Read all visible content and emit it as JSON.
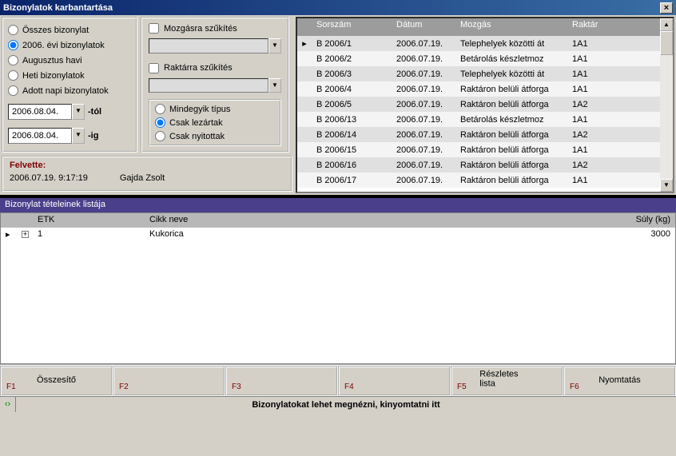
{
  "title": "Bizonylatok karbantartása",
  "filters": {
    "radios": [
      "Összes bizonylat",
      "2006. évi bizonylatok",
      "Augusztus havi",
      "Heti bizonylatok",
      "Adott napi bizonylatok"
    ],
    "dateFrom": "2006.08.04.",
    "dateTo": "2006.08.04.",
    "fromLbl": "-tól",
    "toLbl": "-ig",
    "chkMozgas": "Mozgásra szűkítés",
    "chkRaktar": "Raktárra szűkítés",
    "types": [
      "Mindegyik típus",
      "Csak lezártak",
      "Csak nyitottak"
    ]
  },
  "felvette": {
    "label": "Felvette:",
    "ts": "2006.07.19. 9:17:19",
    "user": "Gajda Zsolt"
  },
  "grid": {
    "headers": [
      "Sorszám",
      "Dátum",
      "Mozgás",
      "Raktár"
    ],
    "rows": [
      {
        "s": "B 2006/1",
        "d": "2006.07.19.",
        "m": "Telephelyek közötti át",
        "r": "1A1"
      },
      {
        "s": "B 2006/2",
        "d": "2006.07.19.",
        "m": "Betárolás készletmoz",
        "r": "1A1"
      },
      {
        "s": "B 2006/3",
        "d": "2006.07.19.",
        "m": "Telephelyek közötti át",
        "r": "1A1"
      },
      {
        "s": "B 2006/4",
        "d": "2006.07.19.",
        "m": "Raktáron belüli átforga",
        "r": "1A1"
      },
      {
        "s": "B 2006/5",
        "d": "2006.07.19.",
        "m": "Raktáron belüli átforga",
        "r": "1A2"
      },
      {
        "s": "B 2006/13",
        "d": "2006.07.19.",
        "m": "Betárolás készletmoz",
        "r": "1A1"
      },
      {
        "s": "B 2006/14",
        "d": "2006.07.19.",
        "m": "Raktáron belüli átforga",
        "r": "1A2"
      },
      {
        "s": "B 2006/15",
        "d": "2006.07.19.",
        "m": "Raktáron belüli átforga",
        "r": "1A1"
      },
      {
        "s": "B 2006/16",
        "d": "2006.07.19.",
        "m": "Raktáron belüli átforga",
        "r": "1A2"
      },
      {
        "s": "B 2006/17",
        "d": "2006.07.19.",
        "m": "Raktáron belüli átforga",
        "r": "1A1"
      }
    ]
  },
  "listTitle": "Bizonylat tételeinek listája",
  "list": {
    "headers": [
      "ETK",
      "Cikk neve",
      "Súly (kg)"
    ],
    "rows": [
      {
        "etk": "1",
        "nev": "Kukorica",
        "suly": "3000"
      }
    ]
  },
  "fkeys": {
    "labels": [
      "F1",
      "F2",
      "F3",
      "F4",
      "F5",
      "F6"
    ],
    "texts": [
      "Összesítő",
      "",
      "",
      "",
      "Részletes lista",
      "Nyomtatás"
    ]
  },
  "status": "Bizonylatokat lehet megnézni, kinyomtatni itt"
}
